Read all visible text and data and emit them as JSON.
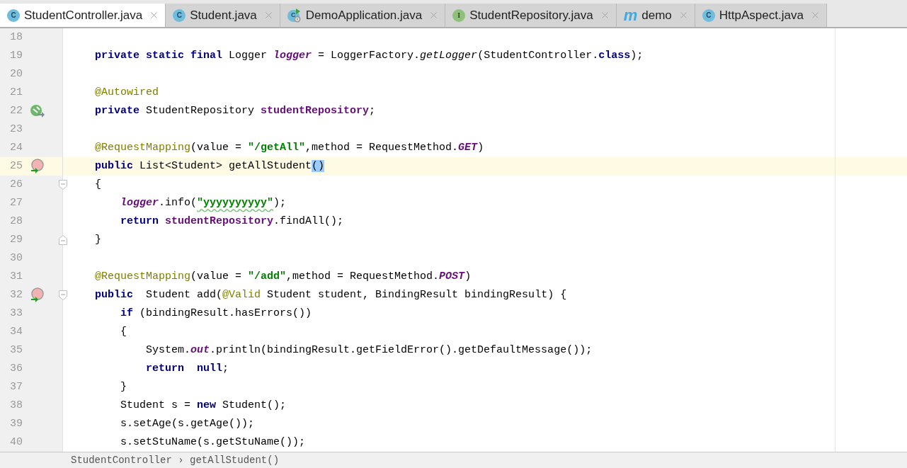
{
  "tabs": [
    {
      "label": "StudentController.java",
      "kind": "class",
      "icon_letter": "C",
      "selected": true
    },
    {
      "label": "Student.java",
      "kind": "class",
      "icon_letter": "C",
      "selected": false
    },
    {
      "label": "DemoApplication.java",
      "kind": "app",
      "icon_letter": "C",
      "selected": false
    },
    {
      "label": "StudentRepository.java",
      "kind": "interface",
      "icon_letter": "I",
      "selected": false
    },
    {
      "label": "demo",
      "kind": "module",
      "icon_letter": "m",
      "selected": false
    },
    {
      "label": "HttpAspect.java",
      "kind": "class",
      "icon_letter": "C",
      "selected": false
    }
  ],
  "editor": {
    "lines": [
      {
        "number": "18"
      },
      {
        "number": "19",
        "tokens": [
          {
            "kind": "keyword",
            "text": "    private static final"
          },
          {
            "kind": "plain",
            "text": " Logger "
          },
          {
            "kind": "static_field",
            "text": "logger"
          },
          {
            "kind": "plain",
            "text": " = LoggerFactory."
          },
          {
            "kind": "static_method",
            "text": "getLogger"
          },
          {
            "kind": "plain",
            "text": "(StudentController."
          },
          {
            "kind": "keyword",
            "text": "class"
          },
          {
            "kind": "plain",
            "text": ");"
          }
        ]
      },
      {
        "number": "20"
      },
      {
        "number": "21",
        "tokens": [
          {
            "kind": "annotation",
            "text": "    @Autowired"
          }
        ]
      },
      {
        "number": "22",
        "gutter": {
          "kind": "bean"
        },
        "tokens": [
          {
            "kind": "keyword",
            "text": "    private"
          },
          {
            "kind": "plain",
            "text": " StudentRepository "
          },
          {
            "kind": "field",
            "text": "studentRepository"
          },
          {
            "kind": "plain",
            "text": ";"
          }
        ]
      },
      {
        "number": "23"
      },
      {
        "number": "24",
        "tokens": [
          {
            "kind": "annotation",
            "text": "    @RequestMapping"
          },
          {
            "kind": "plain",
            "text": "(value = "
          },
          {
            "kind": "string",
            "text": "\"/getAll\""
          },
          {
            "kind": "plain",
            "text": ",method = RequestMethod."
          },
          {
            "kind": "constant",
            "text": "GET"
          },
          {
            "kind": "plain",
            "text": ")"
          }
        ]
      },
      {
        "number": "25",
        "current": true,
        "gutter": {
          "kind": "method"
        },
        "tokens": [
          {
            "kind": "keyword",
            "text": "    public"
          },
          {
            "kind": "plain",
            "text": " List<Student> getAllStudent"
          },
          {
            "kind": "brace_match",
            "text": "()"
          }
        ]
      },
      {
        "number": "26",
        "fold": {
          "kind": "start"
        },
        "tokens": [
          {
            "kind": "plain",
            "text": "    {"
          }
        ]
      },
      {
        "number": "27",
        "tokens": [
          {
            "kind": "static_field",
            "text": "        logger"
          },
          {
            "kind": "plain",
            "text": ".info("
          },
          {
            "kind": "string",
            "text": "\"yyyyyyyyyy\"",
            "typo": true
          },
          {
            "kind": "plain",
            "text": ");"
          }
        ]
      },
      {
        "number": "28",
        "tokens": [
          {
            "kind": "keyword",
            "text": "        return "
          },
          {
            "kind": "field",
            "text": "studentRepository"
          },
          {
            "kind": "plain",
            "text": ".findAll();"
          }
        ]
      },
      {
        "number": "29",
        "fold": {
          "kind": "end"
        },
        "tokens": [
          {
            "kind": "plain",
            "text": "    }"
          }
        ]
      },
      {
        "number": "30"
      },
      {
        "number": "31",
        "tokens": [
          {
            "kind": "annotation",
            "text": "    @RequestMapping"
          },
          {
            "kind": "plain",
            "text": "(value = "
          },
          {
            "kind": "string",
            "text": "\"/add\""
          },
          {
            "kind": "plain",
            "text": ",method = RequestMethod."
          },
          {
            "kind": "constant",
            "text": "POST"
          },
          {
            "kind": "plain",
            "text": ")"
          }
        ]
      },
      {
        "number": "32",
        "gutter": {
          "kind": "method"
        },
        "fold": {
          "kind": "start"
        },
        "tokens": [
          {
            "kind": "keyword",
            "text": "    public"
          },
          {
            "kind": "plain",
            "text": "  Student add("
          },
          {
            "kind": "annotation",
            "text": "@Valid"
          },
          {
            "kind": "plain",
            "text": " Student student, BindingResult bindingResult) {"
          }
        ]
      },
      {
        "number": "33",
        "tokens": [
          {
            "kind": "keyword",
            "text": "        if"
          },
          {
            "kind": "plain",
            "text": " (bindingResult.hasErrors())"
          }
        ]
      },
      {
        "number": "34",
        "tokens": [
          {
            "kind": "plain",
            "text": "        {"
          }
        ]
      },
      {
        "number": "35",
        "tokens": [
          {
            "kind": "plain",
            "text": "            System."
          },
          {
            "kind": "constant",
            "text": "out"
          },
          {
            "kind": "plain",
            "text": ".println(bindingResult.getFieldError().getDefaultMessage());"
          }
        ]
      },
      {
        "number": "36",
        "tokens": [
          {
            "kind": "keyword",
            "text": "            return  null"
          },
          {
            "kind": "plain",
            "text": ";"
          }
        ]
      },
      {
        "number": "37",
        "tokens": [
          {
            "kind": "plain",
            "text": "        }"
          }
        ]
      },
      {
        "number": "38",
        "tokens": [
          {
            "kind": "plain",
            "text": "        Student s = "
          },
          {
            "kind": "keyword",
            "text": "new"
          },
          {
            "kind": "plain",
            "text": " Student();"
          }
        ]
      },
      {
        "number": "39",
        "tokens": [
          {
            "kind": "plain",
            "text": "        s.setAge(s.getAge());"
          }
        ]
      },
      {
        "number": "40",
        "tokens": [
          {
            "kind": "plain",
            "text": "        s.setStuName(s.getStuName());"
          }
        ]
      }
    ]
  },
  "breadcrumb": "StudentController › getAllStudent()"
}
